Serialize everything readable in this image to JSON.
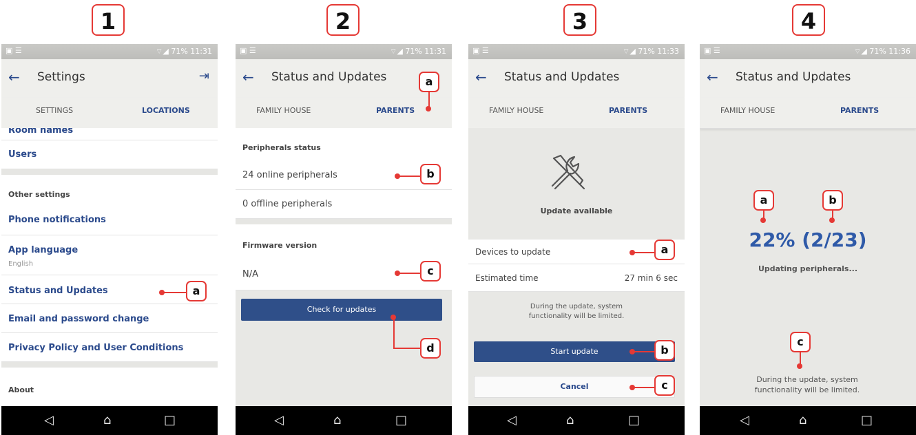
{
  "status_bar": {
    "left": "▣ ☰",
    "right": [
      "⌔◢ 71% 11:31",
      "⌔◢ 71% 11:31",
      "⌔◢ 71% 11:33",
      "⌔◢ 71% 11:36"
    ]
  },
  "steps": [
    "1",
    "2",
    "3",
    "4"
  ],
  "nav": {
    "back": "◁",
    "home": "⌂",
    "recent": "□"
  },
  "screen1": {
    "title": "Settings",
    "tabs": [
      "SETTINGS",
      "LOCATIONS"
    ],
    "items": {
      "room_names": "Room names",
      "users": "Users",
      "other_settings": "Other settings",
      "phone_notifications": "Phone notifications",
      "app_language": "App language",
      "app_language_value": "English",
      "status_updates": "Status and Updates",
      "email_password": "Email and password change",
      "privacy": "Privacy Policy and User Conditions",
      "about": "About"
    },
    "callouts": [
      "a"
    ]
  },
  "screen2": {
    "title": "Status and Updates",
    "tabs": [
      "FAMILY HOUSE",
      "PARENTS"
    ],
    "peripherals_status": "Peripherals status",
    "online": "24 online peripherals",
    "offline": "0 offline peripherals",
    "firmware_version": "Firmware version",
    "firmware_value": "N/A",
    "check_updates": "Check for updates",
    "callouts": [
      "a",
      "b",
      "c",
      "d"
    ]
  },
  "screen3": {
    "title": "Status and Updates",
    "tabs": [
      "FAMILY HOUSE",
      "PARENTS"
    ],
    "update_available": "Update available",
    "devices_to_update": "Devices to update",
    "estimated_time_label": "Estimated time",
    "estimated_time_value": "27 min 6 sec",
    "warning": "During the update, system functionality will be limited.",
    "start_update": "Start update",
    "cancel": "Cancel",
    "callouts": [
      "a",
      "b",
      "c"
    ]
  },
  "screen4": {
    "title": "Status and Updates",
    "tabs": [
      "FAMILY HOUSE",
      "PARENTS"
    ],
    "progress_text": "22% (2/23)",
    "progress_percent": 22,
    "progress_done": 2,
    "progress_total": 23,
    "updating": "Updating peripherals...",
    "warning": "During the update, system functionality will be limited.",
    "callouts": [
      "a",
      "b",
      "c"
    ]
  },
  "colors": {
    "accent": "#2f4f89",
    "callout": "#e53935"
  }
}
